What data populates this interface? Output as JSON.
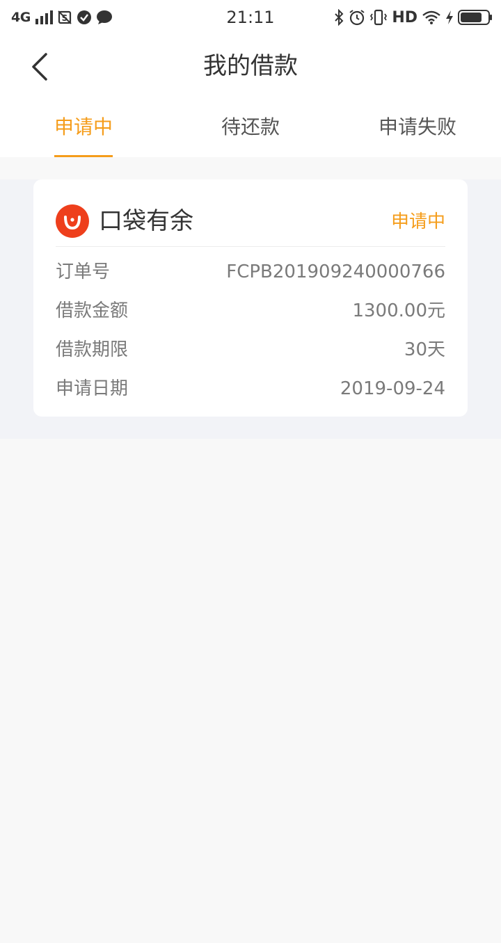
{
  "status_bar": {
    "network": "4G",
    "time": "21:11",
    "hd": "HD"
  },
  "header": {
    "title": "我的借款"
  },
  "tabs": [
    {
      "label": "申请中",
      "active": true
    },
    {
      "label": "待还款",
      "active": false
    },
    {
      "label": "申请失败",
      "active": false
    }
  ],
  "colors": {
    "accent": "#f59d1b",
    "logo": "#ee3f1c"
  },
  "loan_card": {
    "product_name": "口袋有余",
    "status": "申请中",
    "rows": [
      {
        "label": "订单号",
        "value": "FCPB201909240000766"
      },
      {
        "label": "借款金额",
        "value": "1300.00元"
      },
      {
        "label": "借款期限",
        "value": "30天"
      },
      {
        "label": "申请日期",
        "value": "2019-09-24"
      }
    ]
  }
}
